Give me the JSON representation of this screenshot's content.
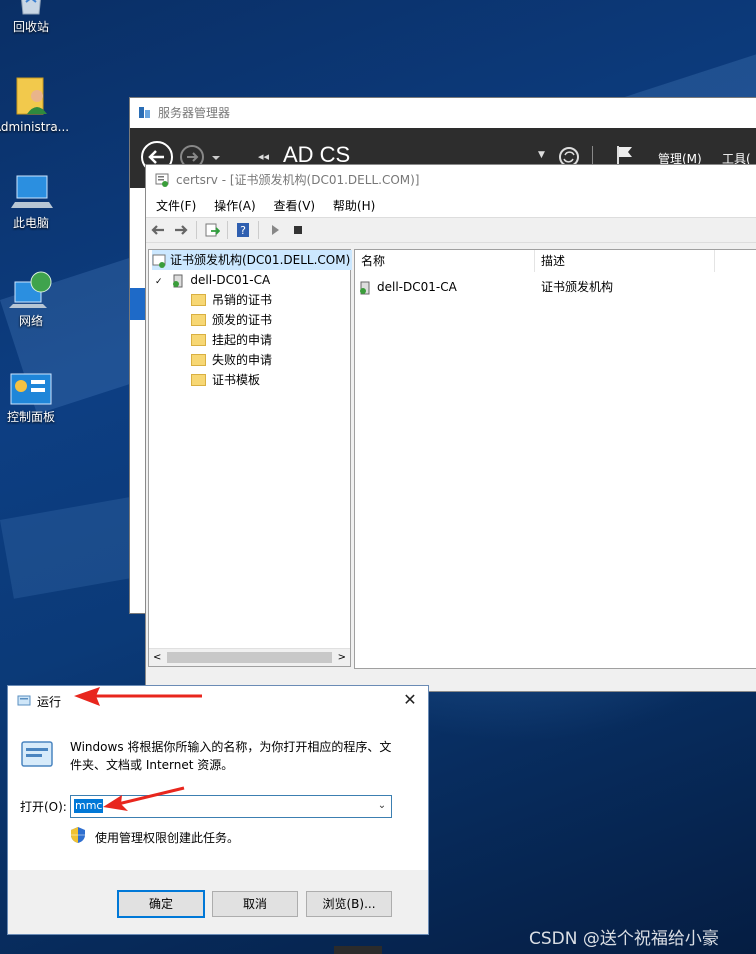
{
  "desktop": {
    "icons": [
      {
        "label": "回收站",
        "icon": "recycle-bin-icon"
      },
      {
        "label": "Administra...",
        "icon": "user-folder-icon"
      },
      {
        "label": "此电脑",
        "icon": "this-pc-icon"
      },
      {
        "label": "网络",
        "icon": "network-icon"
      },
      {
        "label": "控制面板",
        "icon": "control-panel-icon"
      }
    ]
  },
  "server_manager": {
    "window_title": "服务器管理器",
    "page_title": "AD CS",
    "menu_manage": "管理(M)",
    "menu_tools": "工具(",
    "bar_color": "#2d2d2d"
  },
  "mmc": {
    "window_title": "certsrv - [证书颁发机构(DC01.DELL.COM)]",
    "menu": [
      "文件(F)",
      "操作(A)",
      "查看(V)",
      "帮助(H)"
    ],
    "tree": {
      "root": "证书颁发机构(DC01.DELL.COM)",
      "ca": "dell-DC01-CA",
      "folders": [
        "吊销的证书",
        "颁发的证书",
        "挂起的申请",
        "失败的申请",
        "证书模板"
      ]
    },
    "list": {
      "columns": [
        "名称",
        "描述"
      ],
      "rows": [
        {
          "name": "dell-DC01-CA",
          "desc": "证书颁发机构"
        }
      ]
    }
  },
  "run_dialog": {
    "title": "运行",
    "description": "Windows 将根据你所输入的名称，为你打开相应的程序、文件夹、文档或 Internet 资源。",
    "open_label": "打开(O):",
    "input_value": "mmc",
    "admin_note": "使用管理权限创建此任务。",
    "buttons": {
      "ok": "确定",
      "cancel": "取消",
      "browse": "浏览(B)..."
    },
    "accent": "#0078d7",
    "arrow_color": "#e8261d"
  },
  "watermark": "CSDN @送个祝福给小豪"
}
